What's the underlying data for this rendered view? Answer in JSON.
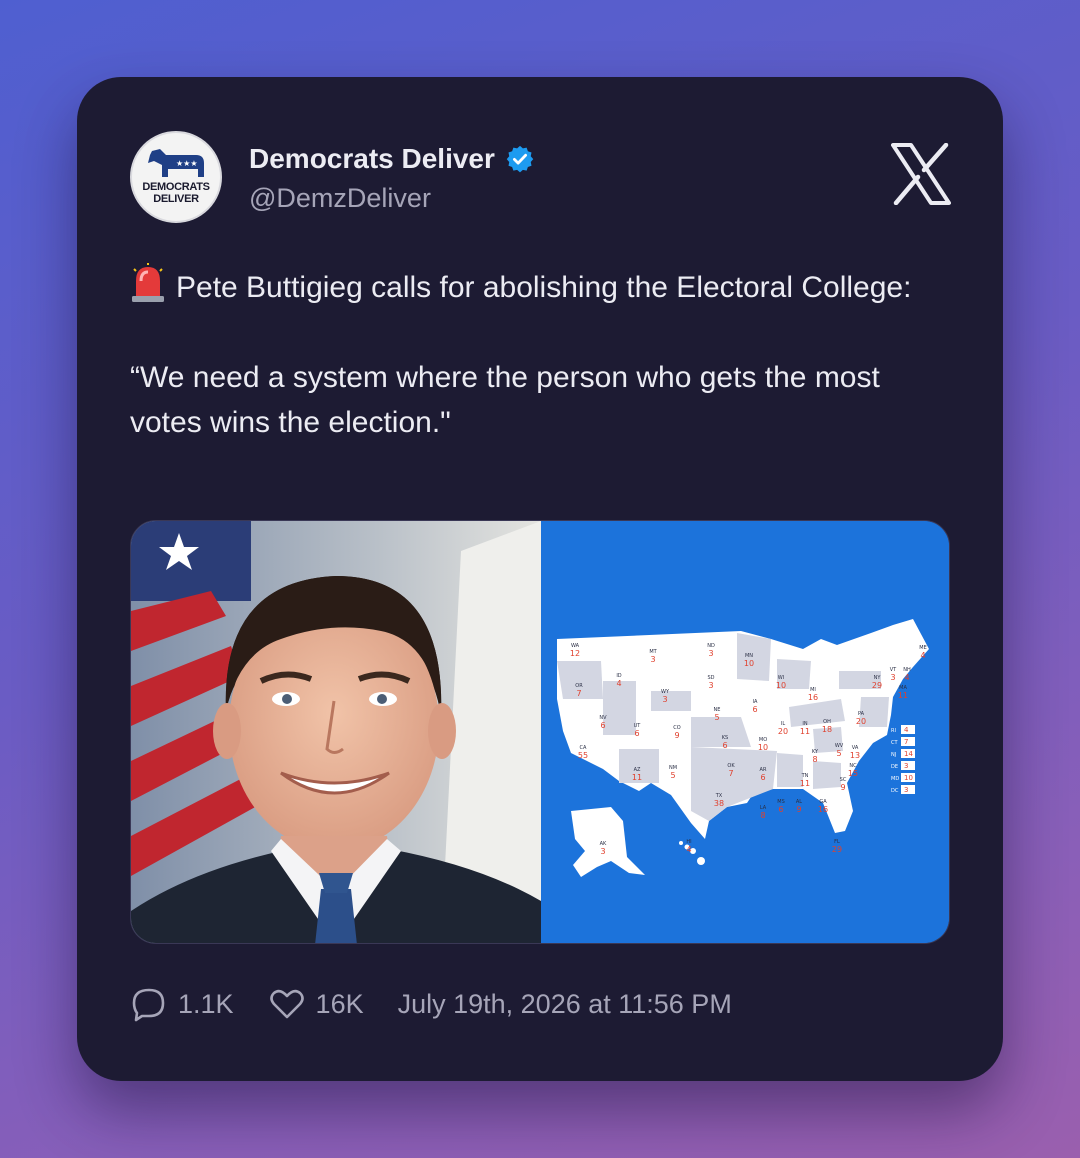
{
  "author": {
    "display_name": "Democrats Deliver",
    "handle": "@DemzDeliver",
    "avatar_text_line1": "DEMOCRATS",
    "avatar_text_line2": "DELIVER"
  },
  "tweet": {
    "emoji": "siren-icon",
    "line1": "Pete Buttigieg calls for abolishing the Electoral College:",
    "line2": "“We need a system where the person who gets the most votes wins the election.\""
  },
  "media": {
    "left": "photo of Pete Buttigieg",
    "right": "US electoral map",
    "map_background": "#1c73db"
  },
  "stats": {
    "replies": "1.1K",
    "likes": "16K",
    "timestamp": "July 19th, 2026 at 11:56 PM"
  },
  "colors": {
    "card": "#1d1b33",
    "text": "#ececf3",
    "muted": "#a6a5b8",
    "verified": "#1d9bf0"
  },
  "map_labels": [
    {
      "st": "WA",
      "ev": "12"
    },
    {
      "st": "OR",
      "ev": "7"
    },
    {
      "st": "CA",
      "ev": "55"
    },
    {
      "st": "NV",
      "ev": "6"
    },
    {
      "st": "ID",
      "ev": "4"
    },
    {
      "st": "MT",
      "ev": "3"
    },
    {
      "st": "WY",
      "ev": "3"
    },
    {
      "st": "UT",
      "ev": "6"
    },
    {
      "st": "AZ",
      "ev": "11"
    },
    {
      "st": "CO",
      "ev": "9"
    },
    {
      "st": "NM",
      "ev": "5"
    },
    {
      "st": "ND",
      "ev": "3"
    },
    {
      "st": "SD",
      "ev": "3"
    },
    {
      "st": "NE",
      "ev": "5"
    },
    {
      "st": "KS",
      "ev": "6"
    },
    {
      "st": "OK",
      "ev": "7"
    },
    {
      "st": "TX",
      "ev": "38"
    },
    {
      "st": "MN",
      "ev": "10"
    },
    {
      "st": "IA",
      "ev": "6"
    },
    {
      "st": "MO",
      "ev": "10"
    },
    {
      "st": "AR",
      "ev": "6"
    },
    {
      "st": "LA",
      "ev": "8"
    },
    {
      "st": "WI",
      "ev": "10"
    },
    {
      "st": "IL",
      "ev": "20"
    },
    {
      "st": "MI",
      "ev": "16"
    },
    {
      "st": "IN",
      "ev": "11"
    },
    {
      "st": "OH",
      "ev": "18"
    },
    {
      "st": "KY",
      "ev": "8"
    },
    {
      "st": "TN",
      "ev": "11"
    },
    {
      "st": "MS",
      "ev": "6"
    },
    {
      "st": "AL",
      "ev": "9"
    },
    {
      "st": "GA",
      "ev": "16"
    },
    {
      "st": "FL",
      "ev": "29"
    },
    {
      "st": "SC",
      "ev": "9"
    },
    {
      "st": "NC",
      "ev": "15"
    },
    {
      "st": "VA",
      "ev": "13"
    },
    {
      "st": "WV",
      "ev": "5"
    },
    {
      "st": "PA",
      "ev": "20"
    },
    {
      "st": "NY",
      "ev": "29"
    },
    {
      "st": "VT",
      "ev": "3"
    },
    {
      "st": "NH",
      "ev": "4"
    },
    {
      "st": "ME",
      "ev": "4"
    },
    {
      "st": "MA",
      "ev": "11"
    },
    {
      "st": "AK",
      "ev": "3"
    },
    {
      "st": "HI",
      "ev": "4"
    }
  ],
  "map_legend": [
    {
      "st": "RI",
      "ev": "4"
    },
    {
      "st": "CT",
      "ev": "7"
    },
    {
      "st": "NJ",
      "ev": "14"
    },
    {
      "st": "DE",
      "ev": "3"
    },
    {
      "st": "MD",
      "ev": "10"
    },
    {
      "st": "DC",
      "ev": "3"
    }
  ]
}
